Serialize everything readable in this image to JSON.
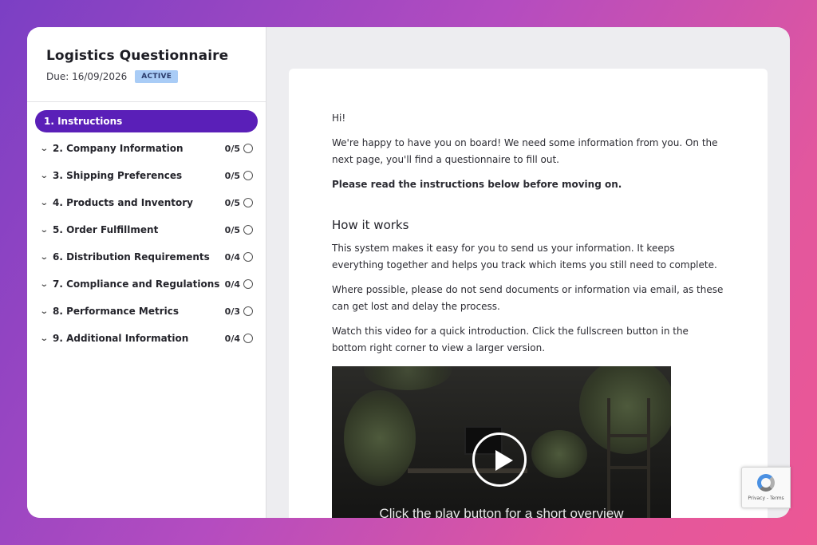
{
  "sidebar": {
    "title": "Logistics Questionnaire",
    "due": "Due: 16/09/2026",
    "status_badge": "ACTIVE",
    "items": [
      {
        "label": "1. Instructions",
        "count": "",
        "active": true
      },
      {
        "label": "2. Company Information",
        "count": "0/5"
      },
      {
        "label": "3. Shipping Preferences",
        "count": "0/5"
      },
      {
        "label": "4. Products and Inventory",
        "count": "0/5"
      },
      {
        "label": "5. Order Fulfillment",
        "count": "0/5"
      },
      {
        "label": "6. Distribution Requirements",
        "count": "0/4"
      },
      {
        "label": "7. Compliance and Regulations",
        "count": "0/4"
      },
      {
        "label": "8. Performance Metrics",
        "count": "0/3"
      },
      {
        "label": "9. Additional Information",
        "count": "0/4"
      }
    ]
  },
  "content": {
    "greeting": "Hi!",
    "intro": "We're happy to have you on board! We need some information from you. On the next page, you'll find a questionnaire to fill out.",
    "instruction": "Please read the instructions below before moving on.",
    "heading": "How it works",
    "para1": "This system makes it easy for you to send us your information. It keeps everything together and helps you track which items you still need to complete.",
    "para2": "Where possible, please do not send documents or information via email, as these can get lost and delay the process.",
    "para3": "Watch this video for a quick introduction. Click the fullscreen button in the bottom right corner to view a larger version.",
    "video_caption": "Click the play button for a short overview"
  },
  "recaptcha": {
    "text": "Privacy - Terms"
  },
  "colors": {
    "accent": "#5a1fb8",
    "badge": "#a9ccf6"
  }
}
